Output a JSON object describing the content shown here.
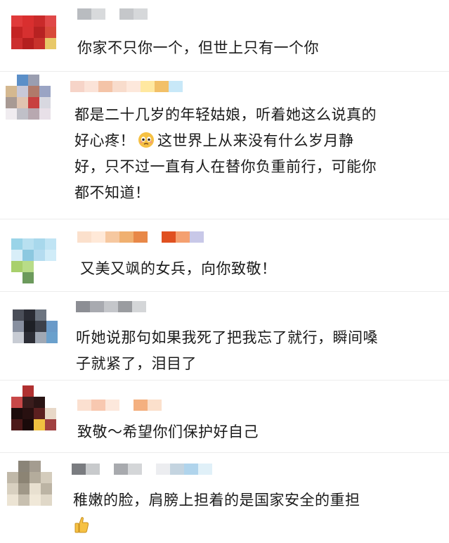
{
  "comments": [
    {
      "lines": [
        "你家不只你一个，但世上只有一个你"
      ],
      "avatar_colors": [
        "#ffffff",
        "#ffffff",
        "#ffffff",
        "#ffffff",
        "#ffffff",
        "#e03a3a",
        "#d92f2f",
        "#c92a2a",
        "#e04848",
        "#ffffff",
        "#c42424",
        "#d63030",
        "#b72222",
        "#d84a3a",
        "#ffffff",
        "#cc2e2e",
        "#b41f1f",
        "#c8322c",
        "#e8c868",
        "#ffffff",
        "#ffffff",
        "#ffffff",
        "#ffffff",
        "#ffffff",
        "#ffffff"
      ],
      "name_colors": [
        "#b9bcc0",
        "#d8dadc",
        "#ffffff",
        "#c5c7ca",
        "#d6d8da"
      ]
    },
    {
      "lines": [
        "都是二十几岁的年轻姑娘，听着她这么说真的",
        "好心疼！",
        "这世界上从来没有什么岁月静",
        "好，只不过一直有人在替你负重前行，可能你",
        "都不知道！"
      ],
      "avatar_colors": [
        "#ffffff",
        "#5b8fc8",
        "#9a9eb0",
        "#ffffff",
        "#ffffff",
        "#d4b890",
        "#c8c8d8",
        "#b07a6a",
        "#9aa4c4",
        "#ffffff",
        "#a89a94",
        "#e0c4b0",
        "#c84040",
        "#d8d8e0",
        "#ffffff",
        "#f0ecf0",
        "#c0c0c8",
        "#b8a8b0",
        "#e8e0e8",
        "#ffffff",
        "#ffffff",
        "#ffffff",
        "#ffffff",
        "#ffffff",
        "#ffffff"
      ],
      "name_colors": [
        "#f6d4c8",
        "#fbe3d8",
        "#f4c4a8",
        "#f8dccc",
        "#fde8dc",
        "#ffe8a0",
        "#f2c068",
        "#c8e8f8"
      ]
    },
    {
      "lines": [
        "又美又飒的女兵，向你致敬！"
      ],
      "avatar_colors": [
        "#ffffff",
        "#ffffff",
        "#ffffff",
        "#ffffff",
        "#ffffff",
        "#9ad4e8",
        "#b8e0f0",
        "#a8d8ec",
        "#c0e4f4",
        "#ffffff",
        "#d8eef8",
        "#8cc8e0",
        "#b4dcf0",
        "#d0ecf8",
        "#ffffff",
        "#a8d06c",
        "#b8dc88",
        "#ffffff",
        "#ffffff",
        "#ffffff",
        "#ffffff",
        "#6c9a5c",
        "#ffffff",
        "#ffffff",
        "#ffffff"
      ],
      "name_colors": [
        "#fbe0cc",
        "#ffe9d8",
        "#f6c8a0",
        "#f0b070",
        "#e88848",
        "#ffffff",
        "#e05020",
        "#f4a070",
        "#c8c8e8"
      ]
    },
    {
      "lines": [
        "听她说那句如果我死了把我忘了就行，瞬间嗓",
        "子就紧了，泪目了"
      ],
      "avatar_colors": [
        "#ffffff",
        "#ffffff",
        "#ffffff",
        "#ffffff",
        "#ffffff",
        "#4a4e58",
        "#2a2c34",
        "#6c7480",
        "#ffffff",
        "#ffffff",
        "#8890a0",
        "#1e2026",
        "#3c404a",
        "#6a9ac8",
        "#ffffff",
        "#c8ccd4",
        "#2c2e36",
        "#a0a8b4",
        "#6aa0cc",
        "#ffffff",
        "#ffffff",
        "#ffffff",
        "#ffffff",
        "#ffffff",
        "#ffffff"
      ],
      "name_colors": [
        "#8c8e94",
        "#a8aab0",
        "#c4c6ca",
        "#9a9ca0",
        "#d4d6d8"
      ]
    },
    {
      "lines": [
        "致敬～希望你们保护好自己"
      ],
      "avatar_colors": [
        "#ffffff",
        "#b03030",
        "#ffffff",
        "#ffffff",
        "#ffffff",
        "#c84848",
        "#3a1c1c",
        "#2a1414",
        "#ffffff",
        "#ffffff",
        "#1c0c0c",
        "#281010",
        "#5c2020",
        "#e8d8c8",
        "#ffffff",
        "#4c1818",
        "#1a0a0a",
        "#f0c040",
        "#a04040",
        "#ffffff",
        "#ffffff",
        "#ffffff",
        "#ffffff",
        "#ffffff",
        "#ffffff"
      ],
      "name_colors": [
        "#fbe0d0",
        "#f8c8b0",
        "#fde8dc",
        "#ffffff",
        "#f4b080",
        "#fbe0cc"
      ]
    },
    {
      "lines": [
        "稚嫩的脸，肩膀上担着的是国家安全的重担"
      ],
      "avatar_colors": [
        "#ffffff",
        "#8a8478",
        "#a49c90",
        "#ffffff",
        "#ffffff",
        "#c0b8a8",
        "#8c8474",
        "#b4ac9c",
        "#d4ccbc",
        "#ffffff",
        "#d8d0c0",
        "#a09888",
        "#e8e0d0",
        "#bcb4a4",
        "#ffffff",
        "#ece4d4",
        "#c8c0b0",
        "#f0e8d8",
        "#e0d8c8",
        "#ffffff",
        "#ffffff",
        "#ffffff",
        "#ffffff",
        "#ffffff",
        "#ffffff"
      ],
      "name_colors": [
        "#7a7c80",
        "#c8cacc",
        "#ffffff",
        "#a8aaae",
        "#d4d6d8",
        "#ffffff",
        "#ecedf0",
        "#c4d4e0",
        "#b0d4ec",
        "#e0f0f8"
      ]
    }
  ]
}
